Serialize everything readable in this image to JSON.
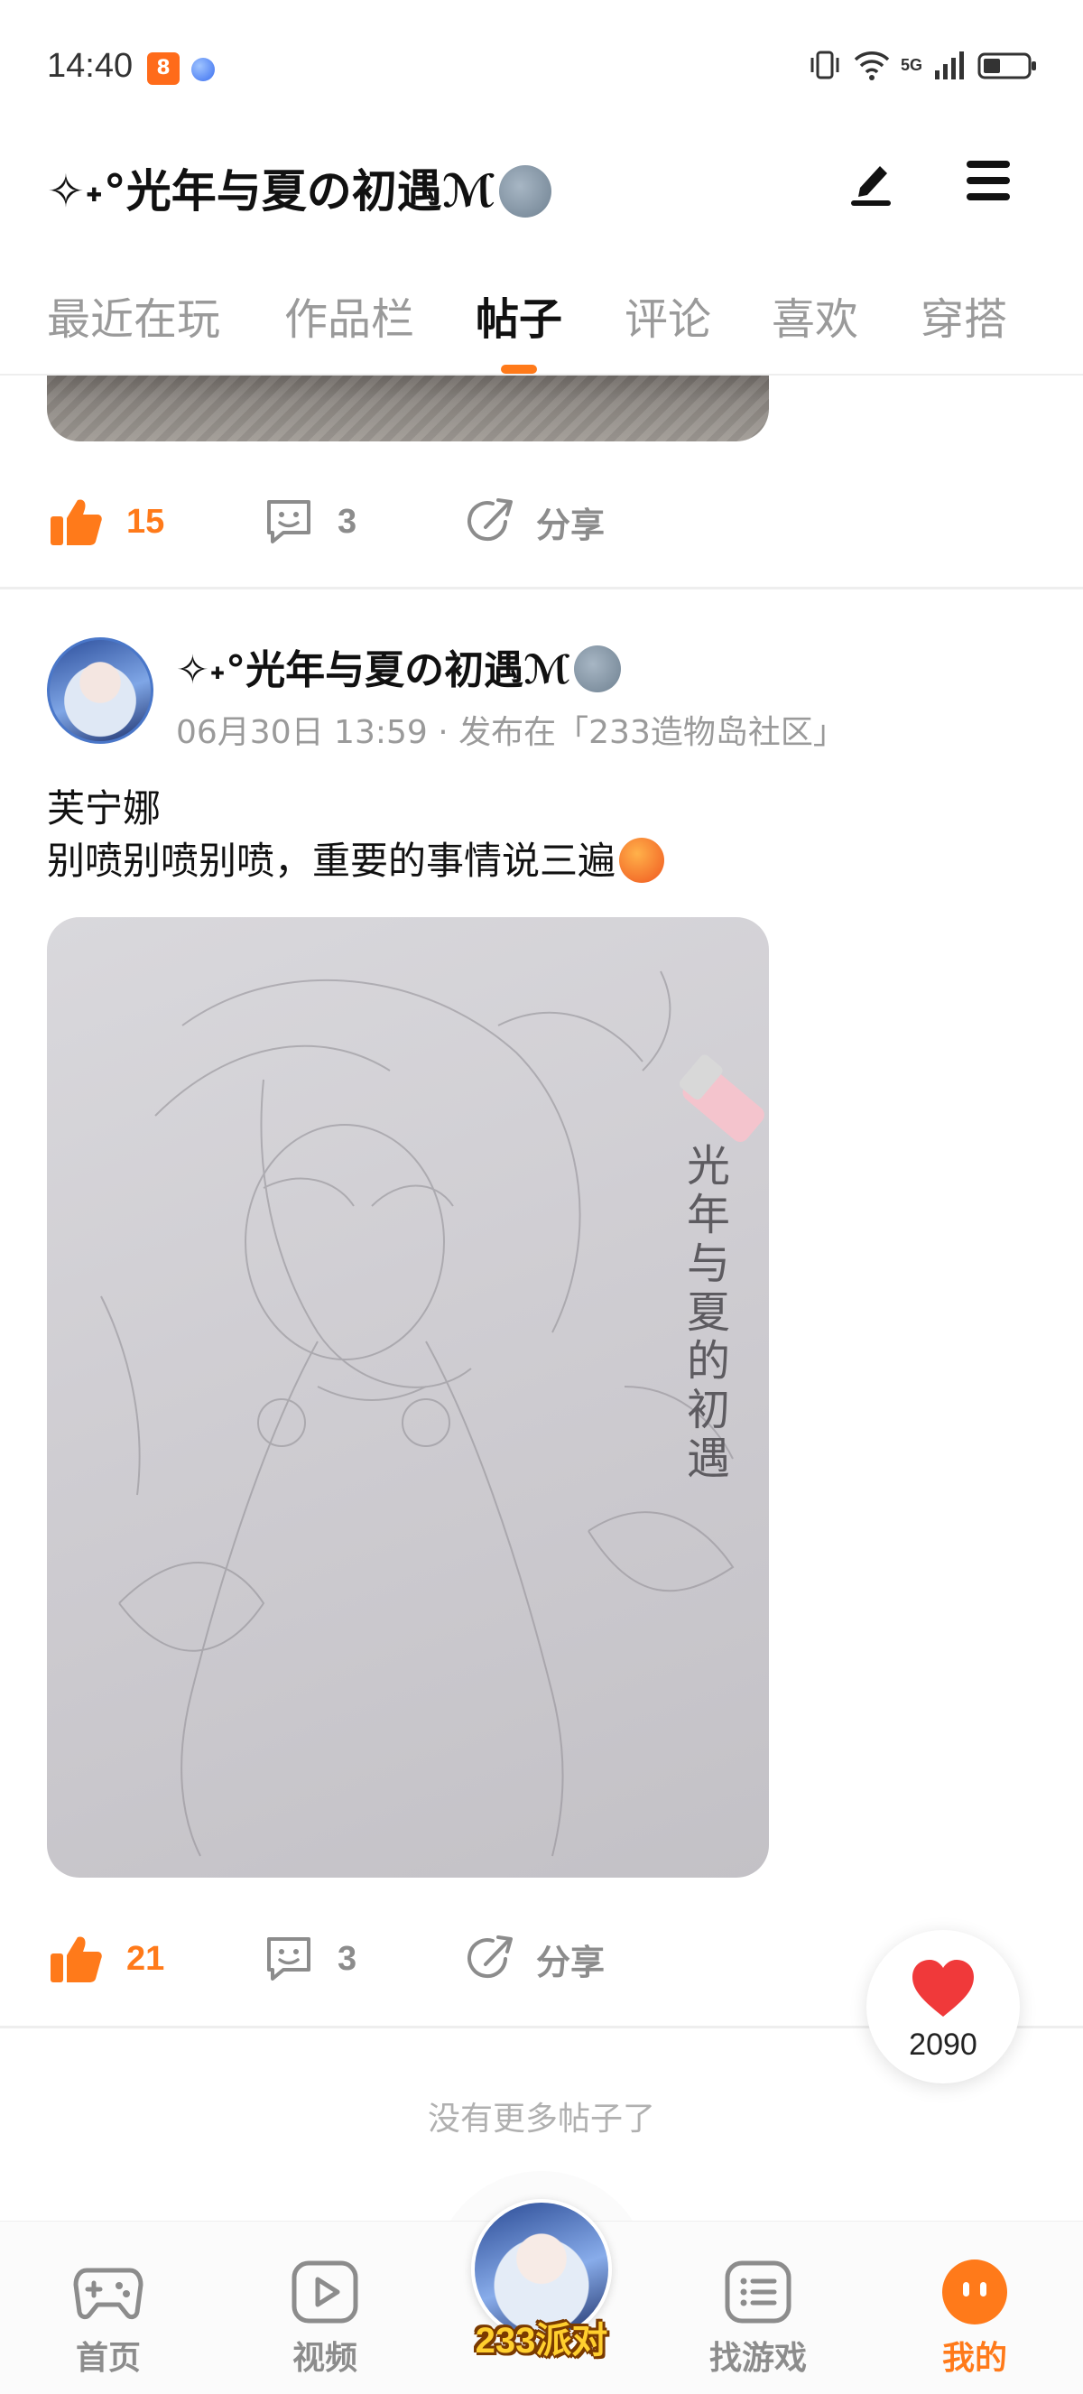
{
  "status_bar": {
    "time": "14:40",
    "app_badge": "8",
    "signal_label": "5G"
  },
  "header": {
    "title": "✧˖°光年与夏の初遇ℳ"
  },
  "tabs": [
    {
      "label": "最近在玩",
      "active": false
    },
    {
      "label": "作品栏",
      "active": false
    },
    {
      "label": "帖子",
      "active": true
    },
    {
      "label": "评论",
      "active": false
    },
    {
      "label": "喜欢",
      "active": false
    },
    {
      "label": "穿搭",
      "active": false
    }
  ],
  "prev_post": {
    "likes": "15",
    "comments": "3",
    "share_label": "分享"
  },
  "post": {
    "author": "✧˖°光年与夏の初遇ℳ",
    "meta": "06月30日 13:59 · 发布在「233造物岛社区」",
    "title": "芙宁娜",
    "body": "别喷别喷别喷，重要的事情说三遍",
    "image_caption": "光年与夏的初遇",
    "likes": "21",
    "comments": "3",
    "share_label": "分享"
  },
  "floating_like": {
    "count": "2090"
  },
  "end_note": "没有更多帖子了",
  "bottom_nav": {
    "home": "首页",
    "video": "视频",
    "center": "233派对",
    "find_games": "找游戏",
    "mine": "我的"
  },
  "colors": {
    "accent": "#ff7a1a",
    "muted": "#8c8c8c",
    "divider": "#eeeeee"
  }
}
